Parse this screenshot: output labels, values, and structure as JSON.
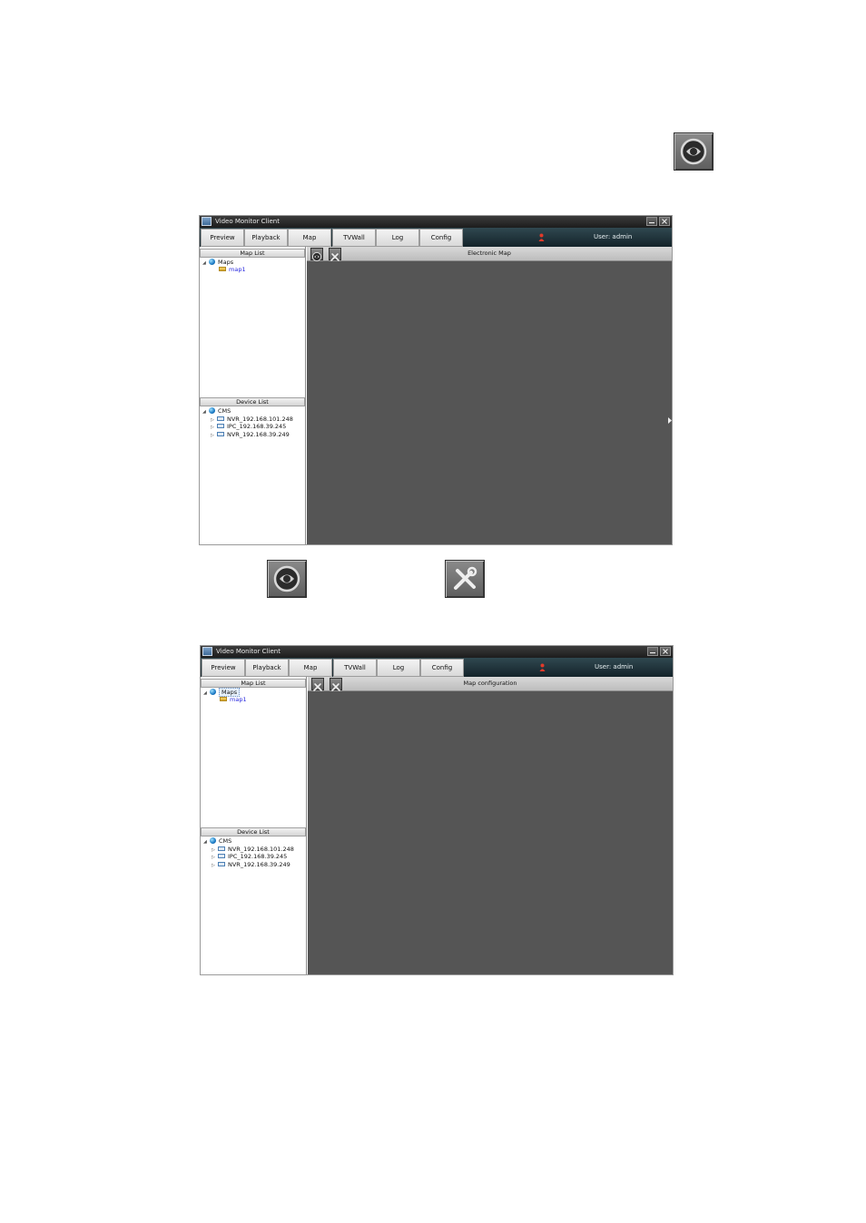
{
  "windows": [
    {
      "title": "Video Monitor Client",
      "tabs": [
        "Preview",
        "Playback",
        "Map",
        "TVWall",
        "Log",
        "Config"
      ],
      "user_label": "User: admin",
      "map_list": {
        "header": "Map List",
        "root": "Maps",
        "items": [
          "map1"
        ]
      },
      "device_list": {
        "header": "Device List",
        "root": "CMS",
        "items": [
          "NVR_192.168.101.248",
          "IPC_192.168.39.245",
          "NVR_192.168.39.249"
        ]
      },
      "main_title": "Electronic Map"
    },
    {
      "title": "Video Monitor Client",
      "tabs": [
        "Preview",
        "Playback",
        "Map",
        "TVWall",
        "Log",
        "Config"
      ],
      "user_label": "User: admin",
      "map_list": {
        "header": "Map List",
        "root": "Maps",
        "items": [
          "map1"
        ]
      },
      "device_list": {
        "header": "Device List",
        "root": "CMS",
        "items": [
          "NVR_192.168.101.248",
          "IPC_192.168.39.245",
          "NVR_192.168.39.249"
        ]
      },
      "main_title": "Map configuration"
    }
  ],
  "icons": {
    "top_right": "eye-icon",
    "under_window_left": "eye-icon",
    "under_window_right": "tools-icon"
  },
  "colors": {
    "menubar": "#1f333a",
    "workspace": "#555555",
    "link_item": "#2a2adf"
  }
}
